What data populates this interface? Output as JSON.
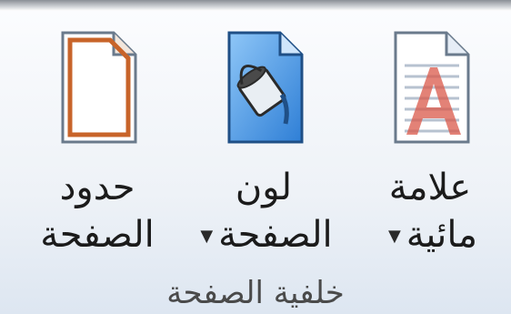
{
  "ribbon_group": {
    "title": "خلفية الصفحة",
    "buttons": [
      {
        "id": "watermark",
        "line1": "علامة",
        "line2": "مائية",
        "has_dropdown": true,
        "icon": "watermark-icon"
      },
      {
        "id": "page-color",
        "line1": "لون",
        "line2": "الصفحة",
        "has_dropdown": true,
        "icon": "paint-bucket-icon"
      },
      {
        "id": "page-borders",
        "line1": "حدود",
        "line2": "الصفحة",
        "has_dropdown": false,
        "icon": "page-borders-icon"
      }
    ]
  },
  "colors": {
    "accent_blue": "#3b8fe0",
    "border_orange": "#c8642a",
    "watermark_red": "#d9584a"
  }
}
